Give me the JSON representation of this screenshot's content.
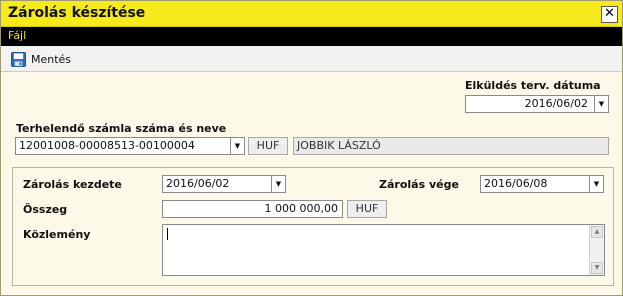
{
  "window": {
    "title": "Zárolás készítése",
    "close_glyph": "✕"
  },
  "menu": {
    "items": [
      {
        "label": "Fájl"
      }
    ]
  },
  "toolbar": {
    "save_label": "Mentés",
    "save_icon": "save-floppy-icon"
  },
  "send_date": {
    "label": "Elküldés terv. dátuma",
    "value": "2016/06/02"
  },
  "account": {
    "label": "Terhelendő számla száma és neve",
    "number": "12001008-00008513-00100004",
    "currency": "HUF",
    "holder": "JOBBIK LÁSZLÓ"
  },
  "lock": {
    "start_label": "Zárolás kezdete",
    "start_value": "2016/06/02",
    "end_label": "Zárolás vége",
    "end_value": "2016/06/08",
    "amount_label": "Összeg",
    "amount_value": "1 000 000,00",
    "amount_currency": "HUF",
    "note_label": "Közlemény",
    "note_value": ""
  },
  "glyphs": {
    "dropdown": "▼",
    "scroll_up": "▲",
    "scroll_down": "▼"
  },
  "colors": {
    "titlebar": "#f6ea1c",
    "menubar": "#000000",
    "menu_text": "#f2e020",
    "background": "#fdf9e8"
  }
}
